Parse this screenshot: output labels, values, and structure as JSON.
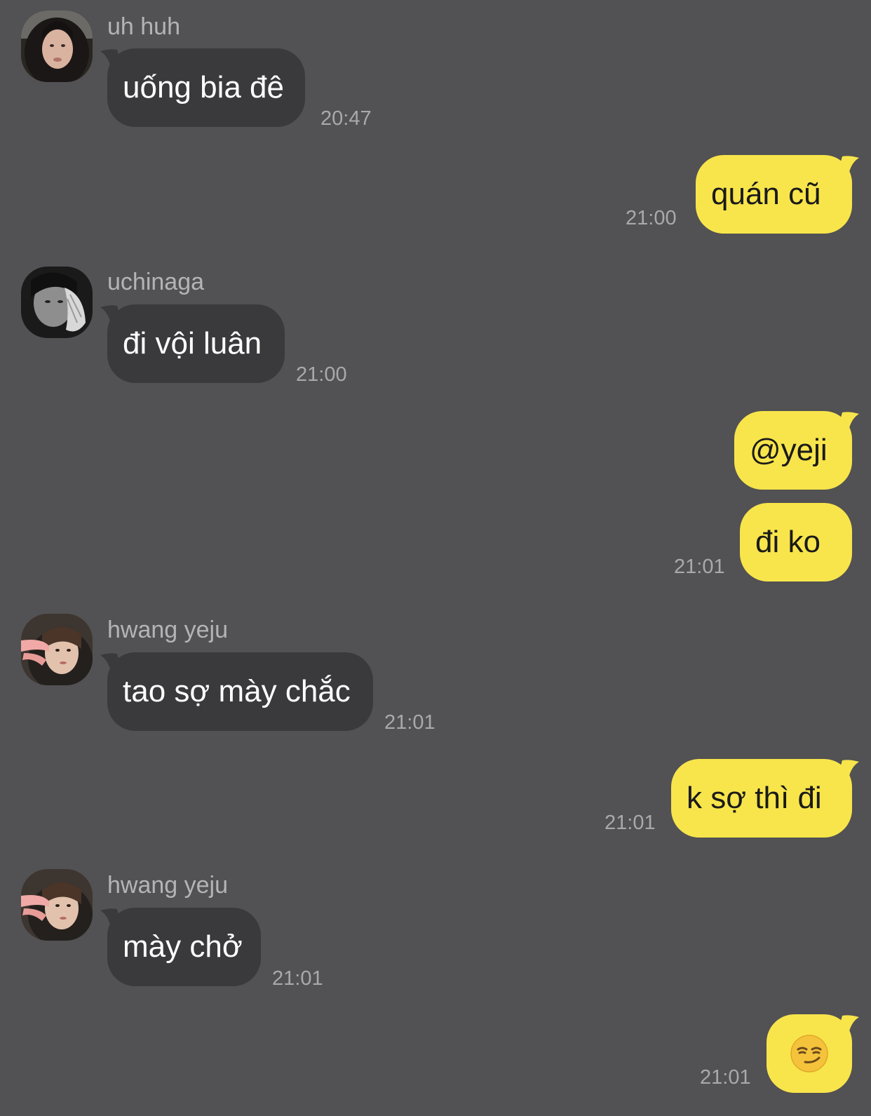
{
  "colors": {
    "background": "#525153",
    "incoming_bubble": "#3a393c",
    "outgoing_bubble": "#f8e54b",
    "meta_text": "#b4b4b6"
  },
  "messages": [
    {
      "sender": "uh huh",
      "text": "uống bia đê",
      "time": "20:47",
      "direction": "incoming",
      "avatar": "avatar-photo-dark-hair"
    },
    {
      "text": "quán cũ",
      "time": "21:00",
      "direction": "outgoing"
    },
    {
      "sender": "uchinaga",
      "text": "đi vội luân",
      "time": "21:00",
      "direction": "incoming",
      "avatar": "avatar-photo-bw-hand-on-face"
    },
    {
      "text": "@yeji",
      "direction": "outgoing"
    },
    {
      "text": "đi ko",
      "time": "21:01",
      "direction": "outgoing"
    },
    {
      "sender": "hwang yeju",
      "text": "tao sợ mày chắc",
      "time": "21:01",
      "direction": "incoming",
      "avatar": "avatar-photo-peace-sign"
    },
    {
      "text": "k sợ thì đi",
      "time": "21:01",
      "direction": "outgoing"
    },
    {
      "sender": "hwang yeju",
      "text": "mày chở",
      "time": "21:01",
      "direction": "incoming",
      "avatar": "avatar-photo-peace-sign"
    },
    {
      "text": "😏",
      "time": "21:01",
      "direction": "outgoing",
      "emoji_name": "smirking-face"
    }
  ]
}
